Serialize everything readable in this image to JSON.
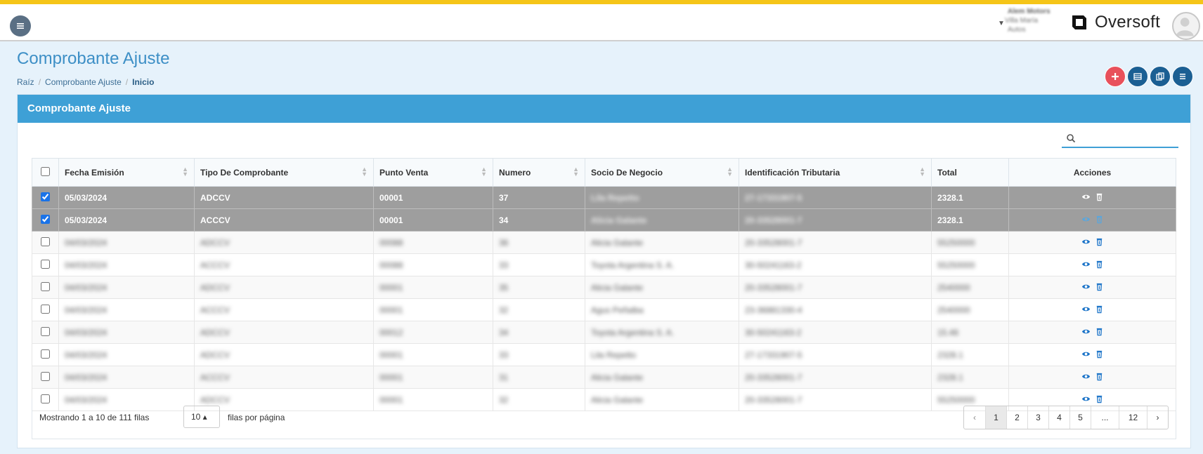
{
  "header": {
    "company_line1": "Alem Motors",
    "company_line2": "Villa María",
    "company_line3": "Autos",
    "brand": "Oversoft"
  },
  "page": {
    "title": "Comprobante Ajuste",
    "breadcrumb": [
      "Raíz",
      "Comprobante Ajuste",
      "Inicio"
    ],
    "card_title": "Comprobante Ajuste"
  },
  "search": {
    "placeholder": "",
    "value": ""
  },
  "table": {
    "columns": [
      "Fecha Emisión",
      "Tipo De Comprobante",
      "Punto Venta",
      "Numero",
      "Socio De Negocio",
      "Identificación Tributaria",
      "Total",
      "Acciones"
    ],
    "rows": [
      {
        "checked": true,
        "fecha": "05/03/2024",
        "tipo": "ADCCV",
        "punto": "00001",
        "numero": "37",
        "socio": "Lila Repetto",
        "ident": "27-17331907-5",
        "total": "2328.1"
      },
      {
        "checked": true,
        "fecha": "05/03/2024",
        "tipo": "ACCCV",
        "punto": "00001",
        "numero": "34",
        "socio": "Alicia Galante",
        "ident": "20-33528001-7",
        "total": "2328.1"
      },
      {
        "checked": false,
        "fecha": "04/03/2024",
        "tipo": "ADCCV",
        "punto": "00088",
        "numero": "36",
        "socio": "Alicia Galante",
        "ident": "20-33528001-7",
        "total": "55250000"
      },
      {
        "checked": false,
        "fecha": "04/03/2024",
        "tipo": "ACCCV",
        "punto": "00088",
        "numero": "33",
        "socio": "Toyota Argentina S. A.",
        "ident": "30-50241163-2",
        "total": "55250000"
      },
      {
        "checked": false,
        "fecha": "04/03/2024",
        "tipo": "ADCCV",
        "punto": "00001",
        "numero": "35",
        "socio": "Alicia Galante",
        "ident": "20-33528001-7",
        "total": "2540000"
      },
      {
        "checked": false,
        "fecha": "04/03/2024",
        "tipo": "ACCCV",
        "punto": "00001",
        "numero": "32",
        "socio": "Agus Peñalba",
        "ident": "23-36881330-4",
        "total": "2540000"
      },
      {
        "checked": false,
        "fecha": "04/03/2024",
        "tipo": "ADCCV",
        "punto": "00012",
        "numero": "34",
        "socio": "Toyota Argentina S. A.",
        "ident": "30-50241163-2",
        "total": "15.46"
      },
      {
        "checked": false,
        "fecha": "04/03/2024",
        "tipo": "ADCCV",
        "punto": "00001",
        "numero": "33",
        "socio": "Lila Repetto",
        "ident": "27-17331907-5",
        "total": "2328.1"
      },
      {
        "checked": false,
        "fecha": "04/03/2024",
        "tipo": "ACCCV",
        "punto": "00001",
        "numero": "31",
        "socio": "Alicia Galante",
        "ident": "20-33528001-7",
        "total": "2328.1"
      },
      {
        "checked": false,
        "fecha": "04/03/2024",
        "tipo": "ADCCV",
        "punto": "00001",
        "numero": "32",
        "socio": "Alicia Galante",
        "ident": "20-33528001-7",
        "total": "55250000"
      }
    ]
  },
  "footer": {
    "showing": "Mostrando 1 a 10 de 111 filas",
    "per_page": "10 ▴",
    "per_page_label": "filas por página",
    "pages": [
      "‹",
      "1",
      "2",
      "3",
      "4",
      "5",
      "...",
      "12",
      "›"
    ]
  },
  "colors": {
    "accent": "#3ea0d6",
    "title": "#3d8fc6",
    "selected_row": "#9e9e9e",
    "action_btn": "#1b5f93",
    "add_btn": "#e8505b",
    "top_stripe": "#f5c518"
  },
  "icons": [
    "menu-icon",
    "chevron-down-icon",
    "oversoft-logo-icon",
    "user-avatar-icon",
    "plus-icon",
    "table-icon",
    "copy-icon",
    "list-icon",
    "search-icon",
    "sort-icon",
    "eye-icon",
    "trash-icon"
  ]
}
